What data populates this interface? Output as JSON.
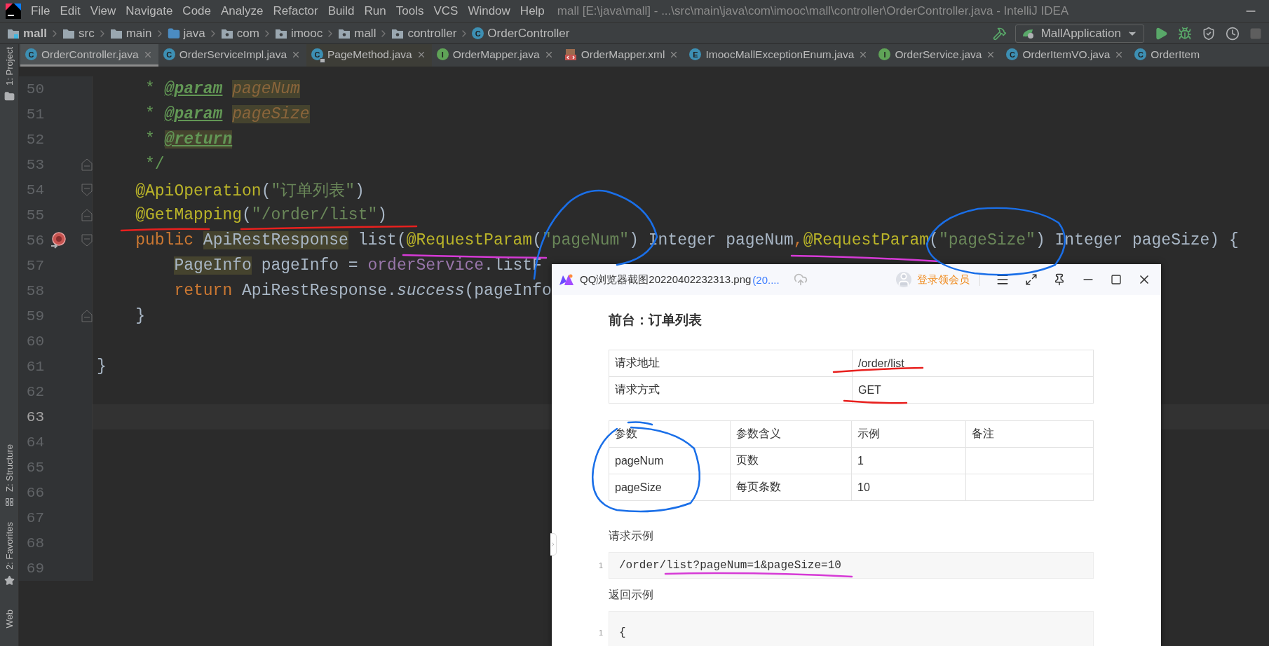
{
  "menu_bar": {
    "items": [
      "File",
      "Edit",
      "View",
      "Navigate",
      "Code",
      "Analyze",
      "Refactor",
      "Build",
      "Run",
      "Tools",
      "VCS",
      "Window",
      "Help"
    ],
    "title": "mall [E:\\java\\mall] - ...\\src\\main\\java\\com\\imooc\\mall\\controller\\OrderController.java - IntelliJ IDEA"
  },
  "breadcrumb": [
    {
      "label": "mall",
      "kind": "module"
    },
    {
      "label": "src",
      "kind": "folder"
    },
    {
      "label": "main",
      "kind": "folder"
    },
    {
      "label": "java",
      "kind": "source"
    },
    {
      "label": "com",
      "kind": "package"
    },
    {
      "label": "imooc",
      "kind": "package"
    },
    {
      "label": "mall",
      "kind": "package"
    },
    {
      "label": "controller",
      "kind": "package"
    },
    {
      "label": "OrderController",
      "kind": "class",
      "icon": "C"
    }
  ],
  "run_config": {
    "label": "MallApplication"
  },
  "tabs": [
    {
      "label": "OrderController.java",
      "kind": "class",
      "icon": "C",
      "selected": true,
      "library": false
    },
    {
      "label": "OrderServiceImpl.java",
      "kind": "class",
      "icon": "C",
      "selected": false,
      "library": false
    },
    {
      "label": "PageMethod.java",
      "kind": "class",
      "icon": "C",
      "selected": false,
      "library": true
    },
    {
      "label": "OrderMapper.java",
      "kind": "interface",
      "icon": "I",
      "selected": false,
      "library": false
    },
    {
      "label": "OrderMapper.xml",
      "kind": "xml",
      "selected": false,
      "library": false
    },
    {
      "label": "ImoocMallExceptionEnum.java",
      "kind": "enum",
      "icon": "E",
      "selected": false,
      "library": false
    },
    {
      "label": "OrderService.java",
      "kind": "interface",
      "icon": "I",
      "selected": false,
      "library": false
    },
    {
      "label": "OrderItemVO.java",
      "kind": "class",
      "icon": "C",
      "selected": false,
      "library": false
    },
    {
      "label": "OrderItem",
      "kind": "class",
      "icon": "C",
      "selected": false,
      "library": false
    }
  ],
  "tool_windows": [
    {
      "label": "1: Project",
      "kind": "folder"
    },
    {
      "label": "Z: Structure",
      "kind": "structure"
    },
    {
      "label": "2: Favorites",
      "kind": "star"
    },
    {
      "label": "Web",
      "kind": "web"
    }
  ],
  "editor": {
    "lines": [
      {
        "number": "50",
        "current": false,
        "kind": "doc",
        "tokens": [
          {
            "text": "* ",
            "kind": "doc"
          },
          {
            "text": "@param",
            "kind": "doctag"
          },
          {
            "text": "pageNum",
            "kind": "docparam-match"
          }
        ]
      },
      {
        "number": "51",
        "current": false,
        "kind": "doc",
        "tokens": [
          {
            "text": "* ",
            "kind": "doc"
          },
          {
            "text": "@param",
            "kind": "doctag"
          },
          {
            "text": "pageSize",
            "kind": "docparam-match"
          }
        ]
      },
      {
        "number": "52",
        "current": false,
        "kind": "doc",
        "tokens": [
          {
            "text": "* ",
            "kind": "doc"
          },
          {
            "text": "@return",
            "kind": "doctag-match"
          }
        ]
      },
      {
        "number": "53",
        "current": false,
        "kind": "doc",
        "gutter_marks": [
          {
            "kind": "fold-end"
          }
        ],
        "tokens": [
          {
            "text": "*/",
            "kind": "doc"
          }
        ]
      },
      {
        "number": "54",
        "current": false,
        "kind": "member",
        "gutter_marks": [
          {
            "kind": "fold-start"
          }
        ],
        "tokens": [
          {
            "text": "@ApiOperation",
            "kind": "annotation"
          },
          {
            "text": "(",
            "kind": "plain"
          },
          {
            "text": "\"订单列表\"",
            "kind": "string"
          },
          {
            "text": ")",
            "kind": "plain"
          }
        ]
      },
      {
        "number": "55",
        "current": false,
        "kind": "member",
        "gutter_marks": [
          {
            "kind": "fold-end"
          }
        ],
        "tokens": [
          {
            "text": "@GetMapping",
            "kind": "annotation"
          },
          {
            "text": "(",
            "kind": "plain"
          },
          {
            "text": "\"/order/list\"",
            "kind": "string"
          },
          {
            "text": ")",
            "kind": "plain"
          }
        ]
      },
      {
        "number": "56",
        "current": false,
        "kind": "member",
        "gutter_marks": [
          {
            "kind": "method"
          },
          {
            "kind": "fold-start"
          }
        ],
        "tokens": [
          {
            "text": "public ",
            "kind": "keyword"
          },
          {
            "text": "ApiRestResponse",
            "kind": "plain-match"
          },
          {
            "text": " list(",
            "kind": "plain"
          },
          {
            "text": "@RequestParam",
            "kind": "annotation"
          },
          {
            "text": "(",
            "kind": "plain"
          },
          {
            "text": "\"pageNum\"",
            "kind": "string"
          },
          {
            "text": ") Integer pageNum",
            "kind": "plain"
          },
          {
            "text": ",",
            "kind": "keyword"
          },
          {
            "text": "@RequestParam",
            "kind": "annotation"
          },
          {
            "text": "(",
            "kind": "plain"
          },
          {
            "text": "\"pageSize\"",
            "kind": "string"
          },
          {
            "text": ") Integer pageSize) {",
            "kind": "plain"
          }
        ]
      },
      {
        "number": "57",
        "current": false,
        "kind": "statement",
        "tokens": [
          {
            "text": "PageInfo",
            "kind": "plain-match"
          },
          {
            "text": " pageInfo = ",
            "kind": "plain"
          },
          {
            "text": "orderService",
            "kind": "field"
          },
          {
            "text": ".listF",
            "kind": "plain"
          }
        ]
      },
      {
        "number": "58",
        "current": false,
        "kind": "statement",
        "tokens": [
          {
            "text": "return ",
            "kind": "keyword"
          },
          {
            "text": "ApiRestResponse.",
            "kind": "plain"
          },
          {
            "text": "success",
            "kind": "italic"
          },
          {
            "text": "(pageInfo",
            "kind": "plain"
          }
        ]
      },
      {
        "number": "59",
        "current": false,
        "kind": "member",
        "gutter_marks": [
          {
            "kind": "fold-end"
          }
        ],
        "tokens": [
          {
            "text": "}",
            "kind": "plain"
          }
        ]
      },
      {
        "number": "60",
        "current": false
      },
      {
        "number": "61",
        "current": false,
        "kind": "class",
        "tokens": [
          {
            "text": "}",
            "kind": "plain"
          }
        ]
      },
      {
        "number": "62",
        "current": false
      },
      {
        "number": "63",
        "current": true
      },
      {
        "number": "64",
        "current": false
      },
      {
        "number": "65",
        "current": false
      },
      {
        "number": "66",
        "current": false
      },
      {
        "number": "67",
        "current": false
      },
      {
        "number": "68",
        "current": false
      },
      {
        "number": "69",
        "current": false
      }
    ]
  },
  "viewer": {
    "file_name": "QQ浏览器截图20220402232313.png",
    "file_size": "(20....",
    "login_label": "登录领会员",
    "document": {
      "heading": "前台：订单列表",
      "info_rows": [
        {
          "label": "请求地址",
          "value": "/order/list"
        },
        {
          "label": "请求方式",
          "value": "GET"
        }
      ],
      "param_columns": [
        "参数",
        "参数含义",
        "示例",
        "备注"
      ],
      "param_rows": [
        {
          "name": "pageNum",
          "meaning": "页数",
          "example": "1"
        },
        {
          "name": "pageSize",
          "meaning": "每页条数",
          "example": "10"
        }
      ],
      "request_example_label": "请求示例",
      "request_example": {
        "line_number": "1",
        "code": "/order/list?pageNum=1&pageSize=10"
      },
      "response_example_label": "返回示例",
      "response_example": {
        "line_number": "1",
        "code": "{"
      }
    }
  }
}
